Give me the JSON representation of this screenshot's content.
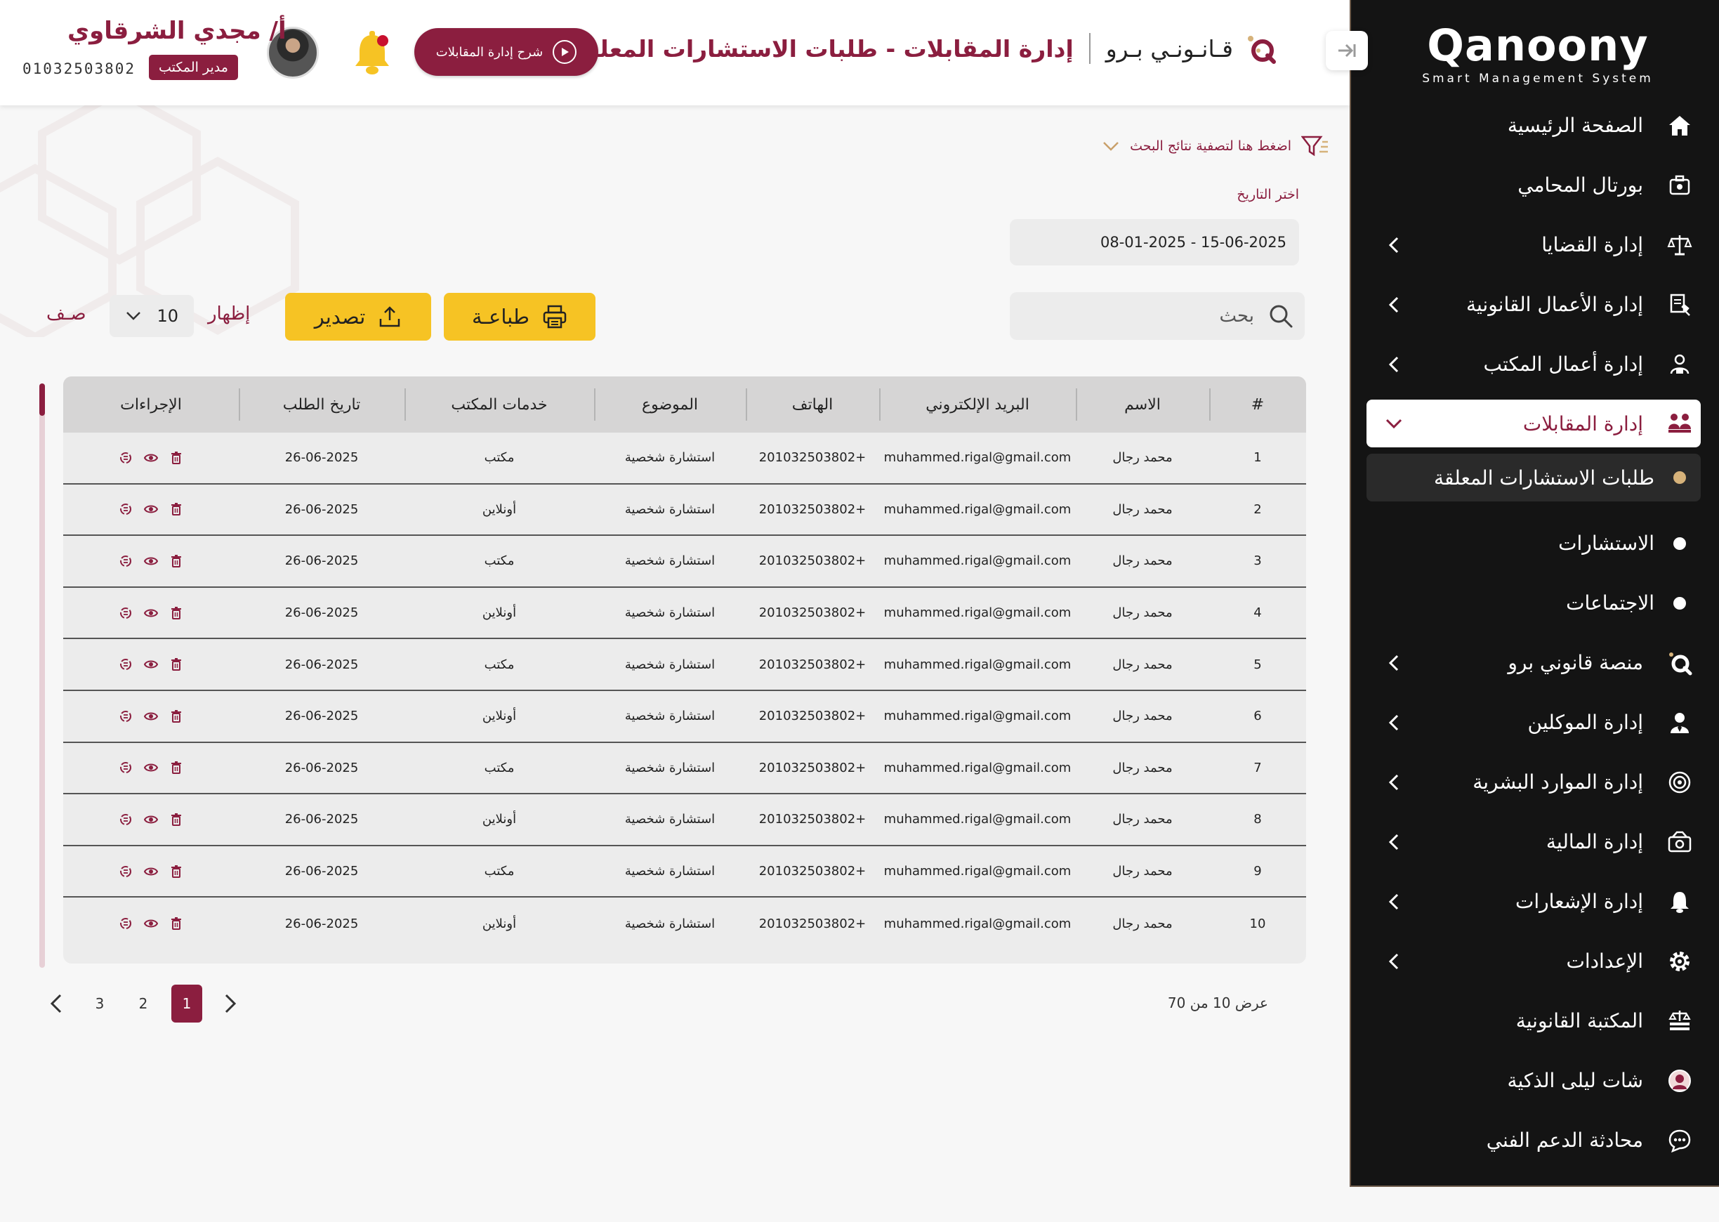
{
  "header": {
    "brand_name": "قـانـونـي بـرو",
    "page_title": "إدارة المقابلات - طلبات الاستشارات المعلقة",
    "explain_button": "شرح إدارة المقابلات",
    "user": {
      "name": "أ/ مجدي الشرقاوي",
      "role": "مدير المكتب",
      "phone": "01032503802"
    }
  },
  "sidebar": {
    "logo": "Qanoony",
    "tagline": "Smart Management System",
    "collapse_icon": "arrow-right-icon",
    "items": [
      {
        "label": "الصفحة الرئيسية",
        "icon": "home-icon",
        "has_chevron": false
      },
      {
        "label": "بورتال المحامي",
        "icon": "portal-icon",
        "has_chevron": false
      },
      {
        "label": "إدارة القضايا",
        "icon": "scales-icon",
        "has_chevron": true
      },
      {
        "label": "إدارة الأعمال القانونية",
        "icon": "document-gavel-icon",
        "has_chevron": true
      },
      {
        "label": "إدارة أعمال المكتب",
        "icon": "office-icon",
        "has_chevron": true
      },
      {
        "label": "إدارة المقابلات",
        "icon": "meeting-icon",
        "has_chevron": true,
        "active": true
      },
      {
        "label": "طلبات الاستشارات المعلقة",
        "sub": true,
        "active": true
      },
      {
        "label": "الاستشارات",
        "sub": true
      },
      {
        "label": "الاجتماعات",
        "sub": true
      },
      {
        "label": "منصة قانوني برو",
        "icon": "platform-icon",
        "has_chevron": true
      },
      {
        "label": "إدارة الموكلين",
        "icon": "client-icon",
        "has_chevron": true
      },
      {
        "label": "إدارة الموارد البشرية",
        "icon": "hr-icon",
        "has_chevron": true
      },
      {
        "label": "إدارة المالية",
        "icon": "money-icon",
        "has_chevron": true
      },
      {
        "label": "إدارة الإشعارات",
        "icon": "bell-icon",
        "has_chevron": true
      },
      {
        "label": "الإعدادات",
        "icon": "gear-icon",
        "has_chevron": true
      },
      {
        "label": "المكتبة القانونية",
        "icon": "library-icon",
        "has_chevron": false
      },
      {
        "label": "شات ليلى الذكية",
        "icon": "ai-chat-icon",
        "has_chevron": false
      },
      {
        "label": "محادثة الدعم الفني",
        "icon": "support-chat-icon",
        "has_chevron": false
      }
    ]
  },
  "filters": {
    "toggle_label": "اضغط هنا لتصفية نتائج البحث",
    "date_label": "اختر التاريخ",
    "date_value": "08-01-2025 - 15-06-2025",
    "search_placeholder": "بحث",
    "print_label": "طباعـة",
    "export_label": "تصدير",
    "show_label": "إظهار",
    "page_size": "10",
    "rows_label": "صـف"
  },
  "table": {
    "columns": [
      "#",
      "الاسم",
      "البريد الإلكتروني",
      "الهاتف",
      "الموضوع",
      "خدمات المكتب",
      "تاريخ الطلب",
      "الإجراءات"
    ],
    "rows": [
      {
        "num": "1",
        "name": "محمد رجال",
        "email": "muhammed.rigal@gmail.com",
        "phone": "+201032503802",
        "subject": "استشارة شخصية",
        "service": "مكتب",
        "date": "26-06-2025"
      },
      {
        "num": "2",
        "name": "محمد رجال",
        "email": "muhammed.rigal@gmail.com",
        "phone": "+201032503802",
        "subject": "استشارة شخصية",
        "service": "أونلاين",
        "date": "26-06-2025"
      },
      {
        "num": "3",
        "name": "محمد رجال",
        "email": "muhammed.rigal@gmail.com",
        "phone": "+201032503802",
        "subject": "استشارة شخصية",
        "service": "مكتب",
        "date": "26-06-2025"
      },
      {
        "num": "4",
        "name": "محمد رجال",
        "email": "muhammed.rigal@gmail.com",
        "phone": "+201032503802",
        "subject": "استشارة شخصية",
        "service": "أونلاين",
        "date": "26-06-2025"
      },
      {
        "num": "5",
        "name": "محمد رجال",
        "email": "muhammed.rigal@gmail.com",
        "phone": "+201032503802",
        "subject": "استشارة شخصية",
        "service": "مكتب",
        "date": "26-06-2025"
      },
      {
        "num": "6",
        "name": "محمد رجال",
        "email": "muhammed.rigal@gmail.com",
        "phone": "+201032503802",
        "subject": "استشارة شخصية",
        "service": "أونلاين",
        "date": "26-06-2025"
      },
      {
        "num": "7",
        "name": "محمد رجال",
        "email": "muhammed.rigal@gmail.com",
        "phone": "+201032503802",
        "subject": "استشارة شخصية",
        "service": "مكتب",
        "date": "26-06-2025"
      },
      {
        "num": "8",
        "name": "محمد رجال",
        "email": "muhammed.rigal@gmail.com",
        "phone": "+201032503802",
        "subject": "استشارة شخصية",
        "service": "أونلاين",
        "date": "26-06-2025"
      },
      {
        "num": "9",
        "name": "محمد رجال",
        "email": "muhammed.rigal@gmail.com",
        "phone": "+201032503802",
        "subject": "استشارة شخصية",
        "service": "مكتب",
        "date": "26-06-2025"
      },
      {
        "num": "10",
        "name": "محمد رجال",
        "email": "muhammed.rigal@gmail.com",
        "phone": "+201032503802",
        "subject": "استشارة شخصية",
        "service": "أونلاين",
        "date": "26-06-2025"
      }
    ],
    "row_actions": [
      "delete-icon",
      "view-icon",
      "convert-icon"
    ]
  },
  "pagination": {
    "info": "عرض 10 من 70",
    "pages": [
      "1",
      "2",
      "3"
    ],
    "current": "1"
  },
  "colors": {
    "primary": "#8b1e3f",
    "accent_yellow": "#f6c324",
    "sidebar_bg": "#141414",
    "sub_active_dot": "#d6b27a"
  }
}
